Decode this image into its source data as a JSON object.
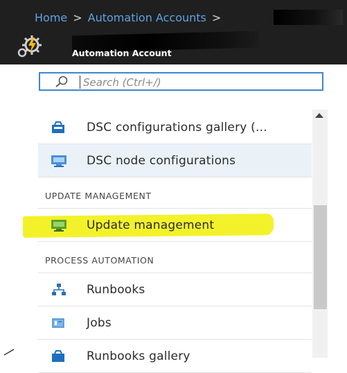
{
  "breadcrumb": {
    "home": "Home",
    "sep1": ">",
    "automation_accounts": "Automation Accounts",
    "sep2": ">"
  },
  "account": {
    "type_label": "Automation Account"
  },
  "search": {
    "placeholder": "Search (Ctrl+/)"
  },
  "menu": {
    "dsc_gallery": "DSC configurations gallery (...",
    "dsc_node": "DSC node configurations",
    "section_update": "UPDATE MANAGEMENT",
    "update_management": "Update management",
    "section_process": "PROCESS AUTOMATION",
    "runbooks": "Runbooks",
    "jobs": "Jobs",
    "runbooks_gallery": "Runbooks gallery"
  },
  "colors": {
    "header_bg": "#1f1f1f",
    "link_blue": "#5ea3e6",
    "highlight": "#f3f22a",
    "selected_row": "#eaf2f8"
  }
}
